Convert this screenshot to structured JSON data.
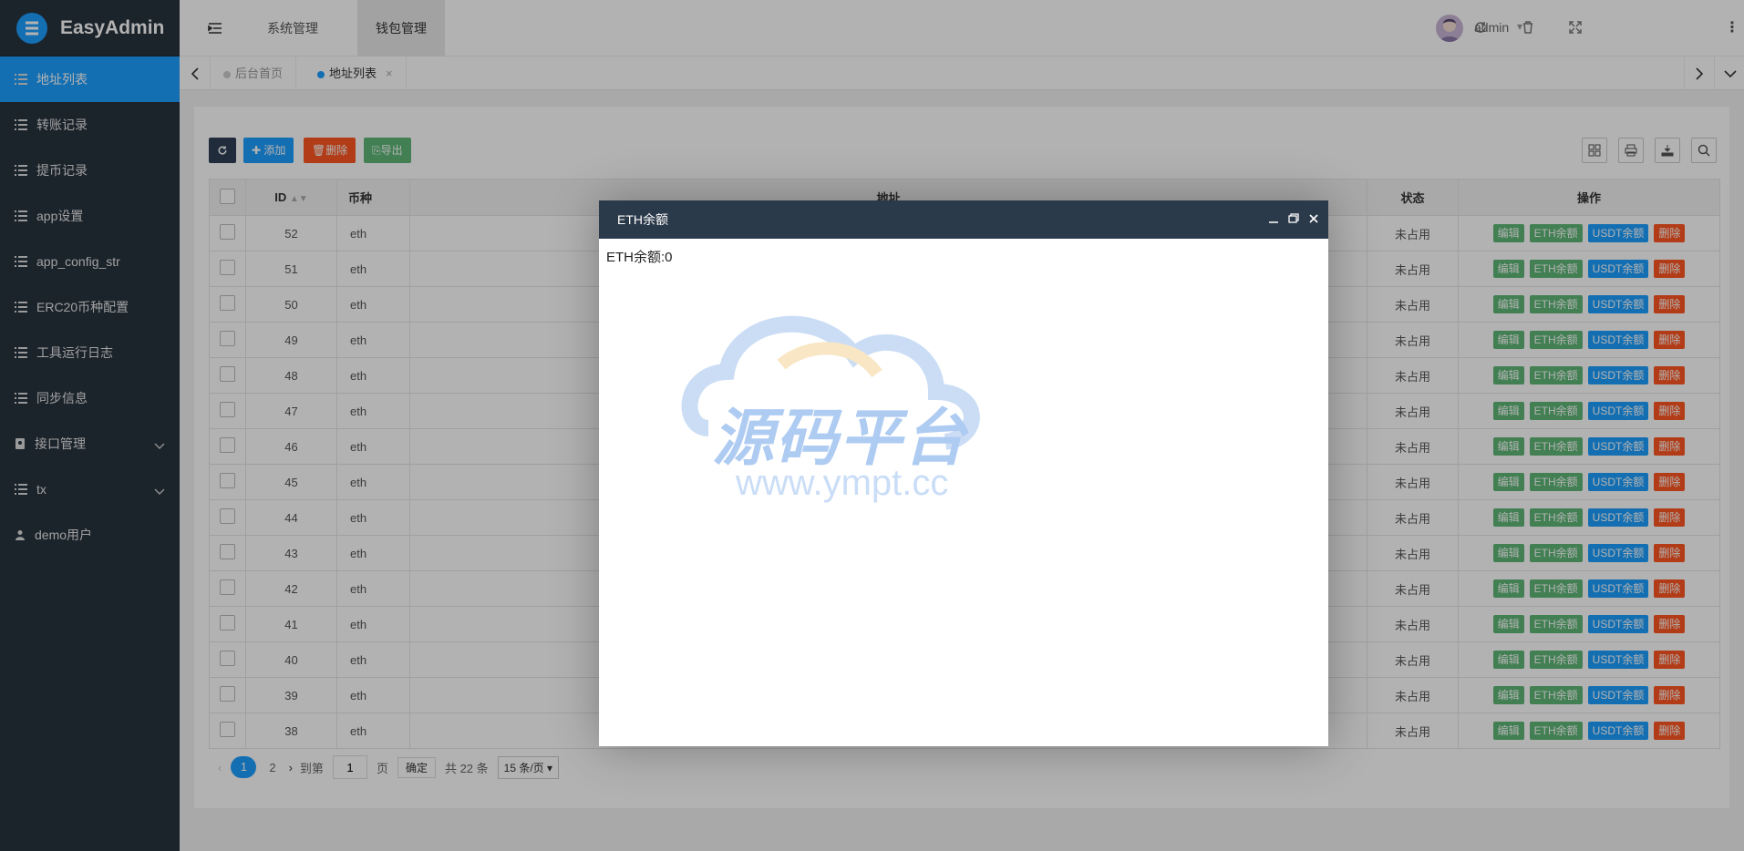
{
  "brand": {
    "title": "EasyAdmin"
  },
  "sidebar": {
    "items": [
      {
        "label": "地址列表",
        "icon": "list-icon"
      },
      {
        "label": "转账记录",
        "icon": "list-icon"
      },
      {
        "label": "提币记录",
        "icon": "list-icon"
      },
      {
        "label": "app设置",
        "icon": "list-icon"
      },
      {
        "label": "app_config_str",
        "icon": "list-icon"
      },
      {
        "label": "ERC20币种配置",
        "icon": "list-icon"
      },
      {
        "label": "工具运行日志",
        "icon": "list-icon"
      },
      {
        "label": "同步信息",
        "icon": "list-icon"
      },
      {
        "label": "接口管理",
        "icon": "address-book-icon"
      },
      {
        "label": "tx",
        "icon": "list-icon"
      },
      {
        "label": "demo用户",
        "icon": "user-icon"
      }
    ]
  },
  "header": {
    "tabs": [
      "系统管理",
      "钱包管理"
    ],
    "user": "admin"
  },
  "tabbar": {
    "tabs": [
      "后台首页",
      "地址列表"
    ]
  },
  "toolbar": {
    "add": "添加",
    "delete": "删除",
    "export": "导出"
  },
  "table": {
    "headers": {
      "id": "ID",
      "coin": "币种",
      "address": "地址",
      "status": "状态",
      "ops": "操作"
    },
    "op_labels": {
      "edit": "编辑",
      "eth": "ETH余额",
      "usdt": "USDT余额",
      "del": "删除"
    },
    "rows": [
      {
        "id": "52",
        "coin": "eth",
        "status": "未占用"
      },
      {
        "id": "51",
        "coin": "eth",
        "status": "未占用"
      },
      {
        "id": "50",
        "coin": "eth",
        "status": "未占用"
      },
      {
        "id": "49",
        "coin": "eth",
        "status": "未占用"
      },
      {
        "id": "48",
        "coin": "eth",
        "status": "未占用"
      },
      {
        "id": "47",
        "coin": "eth",
        "status": "未占用"
      },
      {
        "id": "46",
        "coin": "eth",
        "status": "未占用"
      },
      {
        "id": "45",
        "coin": "eth",
        "status": "未占用"
      },
      {
        "id": "44",
        "coin": "eth",
        "status": "未占用"
      },
      {
        "id": "43",
        "coin": "eth",
        "status": "未占用"
      },
      {
        "id": "42",
        "coin": "eth",
        "status": "未占用"
      },
      {
        "id": "41",
        "coin": "eth",
        "status": "未占用"
      },
      {
        "id": "40",
        "coin": "eth",
        "status": "未占用"
      },
      {
        "id": "39",
        "coin": "eth",
        "status": "未占用"
      },
      {
        "id": "38",
        "coin": "eth",
        "status": "未占用"
      }
    ]
  },
  "pager": {
    "pages": [
      "1",
      "2"
    ],
    "goto_prefix": "到第",
    "goto_value": "1",
    "goto_suffix": "页",
    "confirm": "确定",
    "total": "共 22 条",
    "per_page": "15 条/页"
  },
  "modal": {
    "title": "ETH余额",
    "body": "ETH余额:0"
  },
  "watermark": {
    "text_cn": "源码平台",
    "text_url": "www.ympt.cc"
  },
  "colors": {
    "accent": "#1e9fff",
    "sidebar": "#28333e",
    "success": "#5fb878",
    "danger": "#ff5722"
  }
}
